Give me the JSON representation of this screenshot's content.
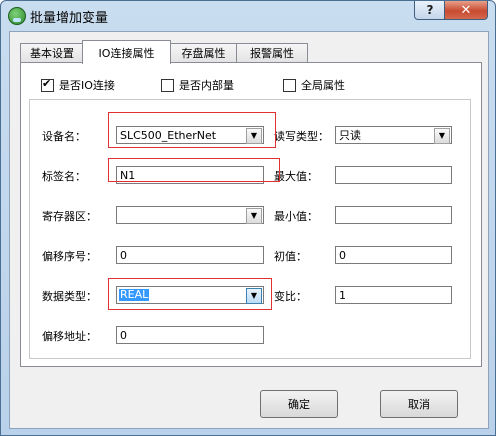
{
  "window": {
    "title": "批量增加变量",
    "help_label": "?",
    "close_label": "✕"
  },
  "tabs": [
    {
      "label": "基本设置"
    },
    {
      "label": "IO连接属性"
    },
    {
      "label": "存盘属性"
    },
    {
      "label": "报警属性"
    }
  ],
  "checkboxes": [
    {
      "label": "是否IO连接",
      "checked": true
    },
    {
      "label": "是否内部量",
      "checked": false
    },
    {
      "label": "全局属性",
      "checked": false
    }
  ],
  "form": {
    "device_label": "设备名：",
    "device_value": "SLC500_EtherNet",
    "tag_label": "标签名：",
    "tag_value": "N1",
    "register_label": "寄存器区：",
    "register_value": "",
    "offset_label": "偏移序号：",
    "offset_value": "0",
    "datatype_label": "数据类型：",
    "datatype_value": "REAL",
    "offset_addr_label": "偏移地址：",
    "offset_addr_value": "0",
    "rw_label": "读写类型：",
    "rw_value": "只读",
    "max_label": "最大值：",
    "max_value": "",
    "min_label": "最小值：",
    "min_value": "",
    "init_label": "初值：",
    "init_value": "0",
    "ratio_label": "变比：",
    "ratio_value": "1"
  },
  "buttons": {
    "ok": "确定",
    "cancel": "取消"
  },
  "colors": {
    "highlight_box": "#e03030",
    "selection": "#3399ff"
  }
}
